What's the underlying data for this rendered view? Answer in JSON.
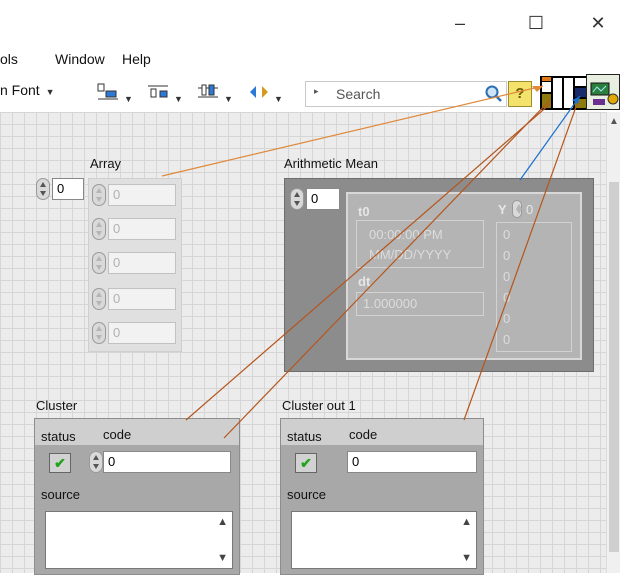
{
  "window": {
    "minimize": "–",
    "maximize": "☐",
    "close": "✕"
  },
  "menu": [
    "ols",
    "Window",
    "Help"
  ],
  "toolbar": {
    "font": "n Font",
    "search_placeholder": "Search",
    "help": "?",
    "icons": [
      "align-objects-icon",
      "distribute-objects-icon",
      "resize-objects-icon",
      "reorder-icon"
    ]
  },
  "panel": {
    "array": {
      "label": "Array",
      "index": "0",
      "elements": [
        "0",
        "0",
        "0",
        "0",
        "0"
      ]
    },
    "arith": {
      "label": "Arithmetic Mean",
      "index": "0",
      "t0_label": "t0",
      "t0_time": "00:00:00 PM",
      "t0_date": "MM/DD/YYYY",
      "dt_label": "dt",
      "dt_value": "1.000000",
      "y_label": "Y",
      "y_index": "0",
      "y_values": [
        "0",
        "0",
        "0",
        "0",
        "0",
        "0"
      ]
    },
    "cluster": {
      "label": "Cluster",
      "status": "status",
      "code": "code",
      "code_value": "0",
      "source": "source"
    },
    "cluster_out": {
      "label": "Cluster out 1",
      "status": "status",
      "code": "code",
      "code_value": "0",
      "source": "source"
    }
  },
  "colors": {
    "wire_orange": "#d4732a",
    "wire_brown": "#b4561e",
    "wire_blue": "#1a6fd1",
    "connector_orange": "#e07a17",
    "connector_olive": "#8c7a10",
    "connector_navy": "#1a2b6b"
  }
}
